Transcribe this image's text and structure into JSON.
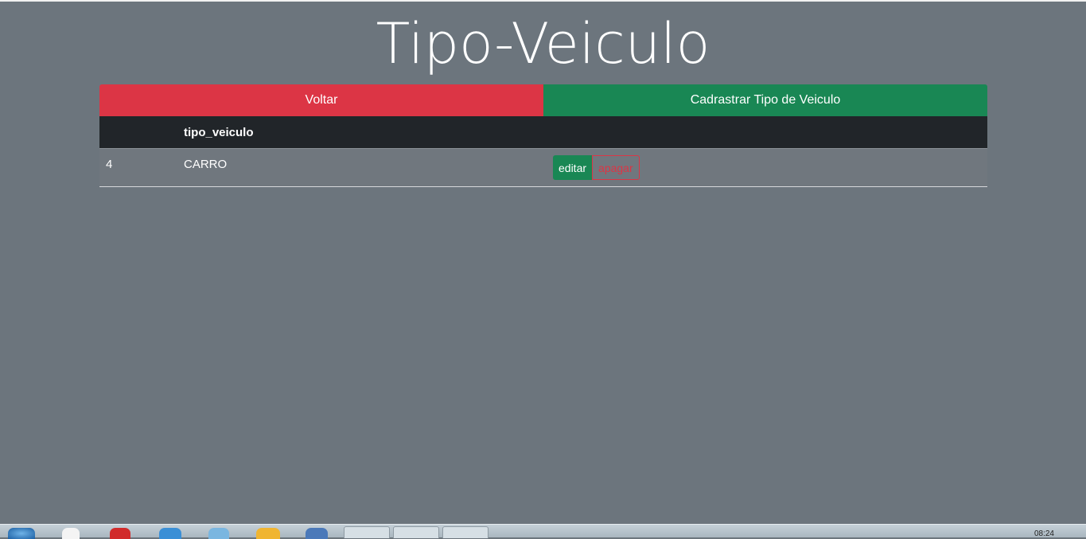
{
  "page": {
    "title": "Tipo-Veiculo"
  },
  "actions": {
    "back_label": "Voltar",
    "new_label": "Cadrastrar Tipo de Veiculo"
  },
  "table": {
    "headers": [
      "",
      "tipo_veiculo",
      ""
    ],
    "rows": [
      {
        "id": "4",
        "tipo_veiculo": "CARRO",
        "edit_label": "editar",
        "delete_label": "apagar"
      }
    ]
  },
  "taskbar": {
    "clock": "08:24"
  },
  "colors": {
    "background": "#6c757d",
    "danger": "#dc3545",
    "success": "#198754",
    "dark": "#212529"
  }
}
